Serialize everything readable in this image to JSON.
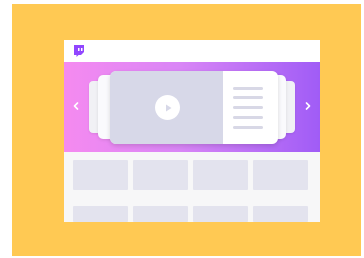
{
  "colors": {
    "backdrop": "#FFC953",
    "window_background": "#F7F7F8",
    "topbar_background": "#FFFFFF",
    "logo": "#9146FF",
    "hero_gradient_start": "#F58AF0",
    "hero_gradient_end": "#A05CF6",
    "video_placeholder": "#D7D8E8",
    "tile_placeholder": "#E3E3EE",
    "arrow": "#FFFFFF"
  },
  "icons": {
    "logo": "twitch-logo-icon",
    "carousel_previous": "chevron-left-icon",
    "carousel_next": "chevron-right-icon",
    "video_play": "play-icon"
  }
}
